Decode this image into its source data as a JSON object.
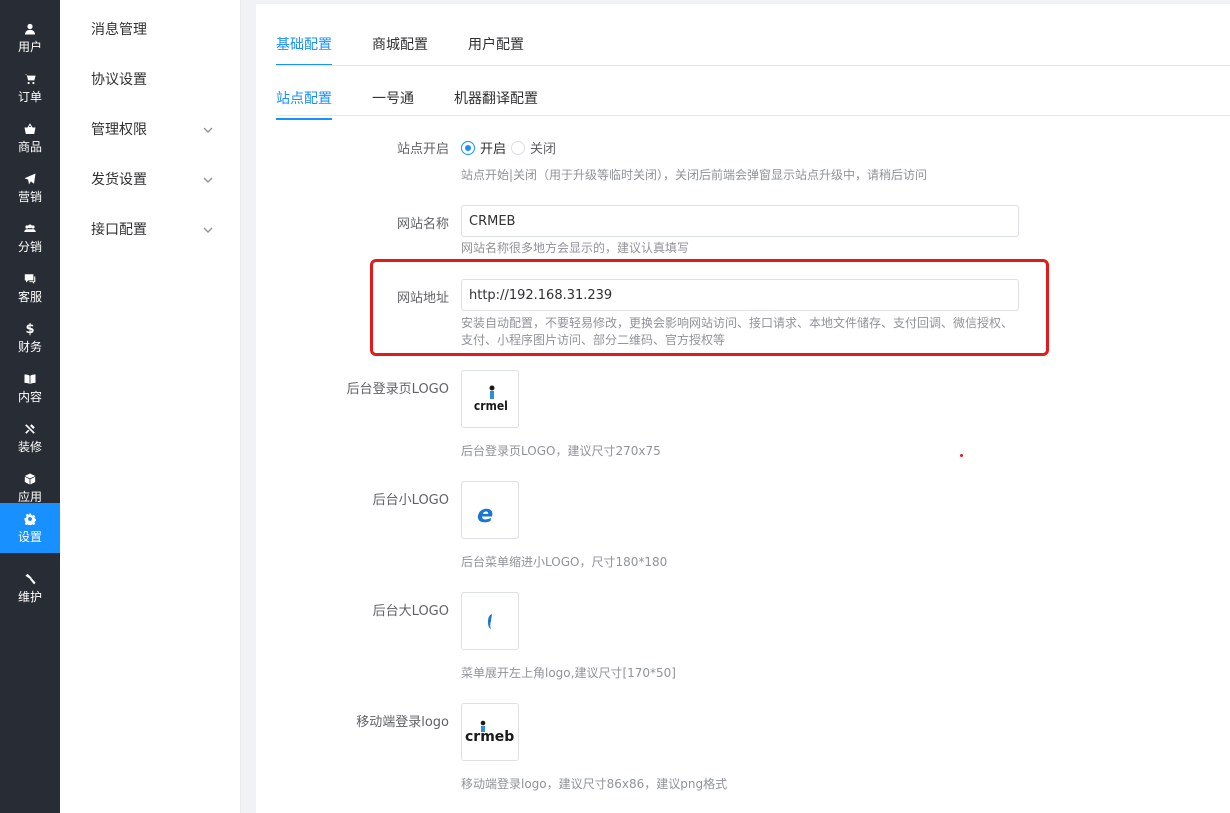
{
  "sidebar": {
    "items": [
      {
        "label": "用户",
        "icon": "user-icon"
      },
      {
        "label": "订单",
        "icon": "cart-icon"
      },
      {
        "label": "商品",
        "icon": "basket-icon"
      },
      {
        "label": "营销",
        "icon": "send-icon"
      },
      {
        "label": "分销",
        "icon": "group-icon"
      },
      {
        "label": "客服",
        "icon": "chat-icon"
      },
      {
        "label": "财务",
        "icon": "dollar-icon"
      },
      {
        "label": "内容",
        "icon": "book-icon"
      },
      {
        "label": "装修",
        "icon": "tools-icon"
      },
      {
        "label": "应用",
        "icon": "cube-icon"
      },
      {
        "label": "设置",
        "icon": "gear-icon",
        "active": true
      },
      {
        "label": "维护",
        "icon": "hammer-icon"
      }
    ],
    "accent": "#1890ff"
  },
  "submenu": {
    "items": [
      {
        "label": "消息管理",
        "expandable": false
      },
      {
        "label": "协议设置",
        "expandable": false
      },
      {
        "label": "管理权限",
        "expandable": true
      },
      {
        "label": "发货设置",
        "expandable": true
      },
      {
        "label": "接口配置",
        "expandable": true
      }
    ]
  },
  "main": {
    "top_tabs": [
      "基础配置",
      "商城配置",
      "用户配置"
    ],
    "active_top_tab": "基础配置",
    "sub_tabs": [
      "站点配置",
      "一号通",
      "机器翻译配置"
    ],
    "active_sub_tab": "站点配置",
    "form": {
      "site_open": {
        "label": "站点开启",
        "options": [
          "开启",
          "关闭"
        ],
        "selected": "开启",
        "help": "站点开始|关闭（用于升级等临时关闭），关闭后前端会弹窗显示站点升级中，请稍后访问"
      },
      "site_name": {
        "label": "网站名称",
        "value": "CRMEB",
        "help": "网站名称很多地方会显示的，建议认真填写"
      },
      "site_url": {
        "label": "网站地址",
        "value": "http://192.168.31.239",
        "help_line1": "安装自动配置，不要轻易修改，更换会影响网站访问、接口请求、本地文件储存、支付回调、微信授权、",
        "help_line2": "支付、小程序图片访问、部分二维码、官方授权等"
      },
      "admin_login_logo": {
        "label": "后台登录页LOGO",
        "help": "后台登录页LOGO，建议尺寸270x75"
      },
      "admin_small_logo": {
        "label": "后台小LOGO",
        "help": "后台菜单缩进小LOGO，尺寸180*180"
      },
      "admin_big_logo": {
        "label": "后台大LOGO",
        "help": "菜单展开左上角logo,建议尺寸[170*50]"
      },
      "mobile_login_logo": {
        "label": "移动端登录logo",
        "help": "移动端登录logo，建议尺寸86x86，建议png格式"
      }
    }
  },
  "highlight_color": "#e31a1a"
}
